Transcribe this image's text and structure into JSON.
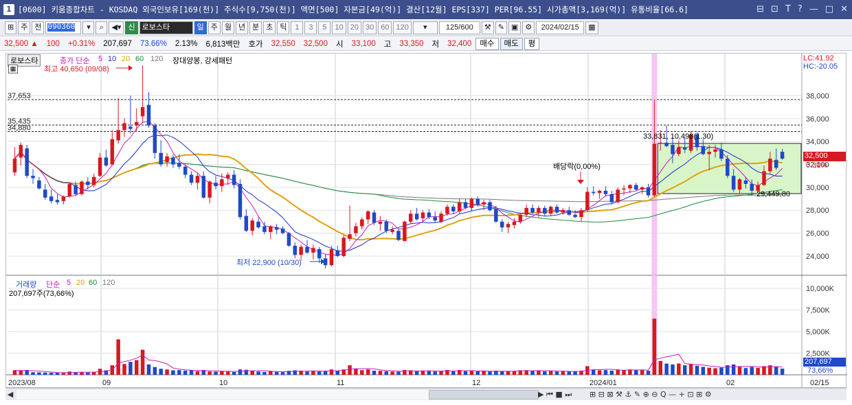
{
  "window": {
    "title": "[0600] 키움종합차트 - KOSDAQ 외국인보유[169(천)] 주식수[9,750(천)] 액면[500] 자본금[49(억)] 결산[12월] EPS[337] PER[96.55] 시가총액[3,169(억)] 유통비율[66.6]",
    "controls": [
      "⊟",
      "⊡",
      "T",
      "?",
      "—",
      "□",
      "✕"
    ]
  },
  "toolbar": {
    "market": "주",
    "prev": "전",
    "code": "090360",
    "robot_label": "신",
    "robot_name": "로보스타",
    "periods": [
      "일",
      "주",
      "월",
      "년",
      "분",
      "초",
      "틱"
    ],
    "period_selected": "일",
    "intervals": [
      "1",
      "3",
      "5",
      "10",
      "20",
      "30",
      "60",
      "120"
    ],
    "count": "125/600",
    "date": "2024/02/15"
  },
  "quote": {
    "price": "32,500",
    "change": "100",
    "rate": "+0.31%",
    "volume": "207,697",
    "vol_ratio": "73.66%",
    "turnover": "2.13%",
    "amount": "6,813백만",
    "ask_label": "호가",
    "ask": "32,550",
    "bid": "32,500",
    "open_label": "시",
    "open": "33,100",
    "high_label": "고",
    "high": "33,350",
    "low_label": "저",
    "low": "32,400",
    "buy_button": "매수",
    "sell_button": "매도",
    "avg_button": "평"
  },
  "chart_data": {
    "type": "candlestick",
    "stock_name": "로보스타",
    "price_legend": {
      "title": "종가 단순",
      "periods": [
        "5",
        "10",
        "20",
        "60",
        "120"
      ],
      "colors": [
        "#c21cbe",
        "#1a2ecb",
        "#e0a010",
        "#1e8a3a",
        "#777777"
      ],
      "pattern": "장대양봉, 강세패턴"
    },
    "lc_label": "LC:41.92",
    "hc_label": "HC:-20.05",
    "price_axis": {
      "ylim": [
        22500,
        40600
      ],
      "ticks": [
        "38,000",
        "36,000",
        "34,000",
        "32,000",
        "30,000",
        "28,000",
        "26,000",
        "24,000"
      ],
      "tick_values": [
        38000,
        36000,
        34000,
        32000,
        30000,
        28000,
        26000,
        24000
      ]
    },
    "reference_lines": [
      {
        "label": "37,653",
        "value": 37653
      },
      {
        "label": "35,435",
        "value": 35435
      },
      {
        "label": "34,880",
        "value": 34880
      }
    ],
    "annotations": {
      "high": "최고 40,650 (09/08)",
      "low": "최저 22,900 (10/30)",
      "dividend": "배당락(0,00%)",
      "box_top": "33,831, 10,498(1.30)",
      "box_bottom": "29,449,80",
      "current_price": "32,500",
      "current_rate": "0.31%"
    },
    "volume_panel": {
      "title": "거래량",
      "ma": "단순",
      "periods": [
        "5",
        "20",
        "60",
        "120"
      ],
      "current": "207,697주(73,66%)",
      "ticks": [
        "10,000K",
        "7,500K",
        "5,000K",
        "2,500K"
      ],
      "tick_values": [
        10000,
        7500,
        5000,
        2500
      ],
      "last_label": "207,697",
      "ratio_label": "73,66%"
    },
    "x_labels": [
      "2023/08",
      "09",
      "10",
      "11",
      "12",
      "2024/01",
      "02",
      "02/15"
    ],
    "candles": [
      {
        "o": 31300,
        "h": 33500,
        "l": 31000,
        "c": 32500
      },
      {
        "o": 32600,
        "h": 33900,
        "l": 31900,
        "c": 33700
      },
      {
        "o": 33400,
        "h": 33700,
        "l": 30800,
        "c": 31000
      },
      {
        "o": 31000,
        "h": 31600,
        "l": 30300,
        "c": 30800
      },
      {
        "o": 30600,
        "h": 30900,
        "l": 29800,
        "c": 29900
      },
      {
        "o": 29800,
        "h": 30300,
        "l": 28900,
        "c": 29100
      },
      {
        "o": 29200,
        "h": 29800,
        "l": 28600,
        "c": 28800
      },
      {
        "o": 28900,
        "h": 29400,
        "l": 28500,
        "c": 28700
      },
      {
        "o": 28800,
        "h": 29300,
        "l": 28500,
        "c": 29200
      },
      {
        "o": 29200,
        "h": 30400,
        "l": 29100,
        "c": 30300
      },
      {
        "o": 30200,
        "h": 30500,
        "l": 29300,
        "c": 29400
      },
      {
        "o": 29400,
        "h": 30600,
        "l": 29300,
        "c": 30500
      },
      {
        "o": 30500,
        "h": 30900,
        "l": 29800,
        "c": 30200
      },
      {
        "o": 30200,
        "h": 31200,
        "l": 30000,
        "c": 30900
      },
      {
        "o": 31000,
        "h": 33000,
        "l": 30900,
        "c": 32600
      },
      {
        "o": 32600,
        "h": 33300,
        "l": 31800,
        "c": 31900
      },
      {
        "o": 32000,
        "h": 35000,
        "l": 31900,
        "c": 34200
      },
      {
        "o": 34100,
        "h": 37800,
        "l": 33800,
        "c": 35000
      },
      {
        "o": 35000,
        "h": 36000,
        "l": 34400,
        "c": 35600
      },
      {
        "o": 35300,
        "h": 38000,
        "l": 34700,
        "c": 35100
      },
      {
        "o": 35400,
        "h": 36900,
        "l": 34900,
        "c": 35700
      },
      {
        "o": 36200,
        "h": 40650,
        "l": 35600,
        "c": 37000
      },
      {
        "o": 37200,
        "h": 38300,
        "l": 35200,
        "c": 35400
      },
      {
        "o": 35400,
        "h": 35600,
        "l": 32500,
        "c": 33000
      },
      {
        "o": 33000,
        "h": 34100,
        "l": 31800,
        "c": 32000
      },
      {
        "o": 32200,
        "h": 33000,
        "l": 31800,
        "c": 32700
      },
      {
        "o": 32600,
        "h": 32900,
        "l": 31700,
        "c": 32000
      },
      {
        "o": 32100,
        "h": 32900,
        "l": 31600,
        "c": 31800
      },
      {
        "o": 31800,
        "h": 32000,
        "l": 30800,
        "c": 31100
      },
      {
        "o": 31100,
        "h": 31400,
        "l": 30200,
        "c": 30400
      },
      {
        "o": 30400,
        "h": 31300,
        "l": 29800,
        "c": 31000
      },
      {
        "o": 31000,
        "h": 31400,
        "l": 29000,
        "c": 29100
      },
      {
        "o": 29100,
        "h": 30600,
        "l": 28600,
        "c": 30500
      },
      {
        "o": 30400,
        "h": 31000,
        "l": 29800,
        "c": 30100
      },
      {
        "o": 30100,
        "h": 31200,
        "l": 29600,
        "c": 30700
      },
      {
        "o": 30800,
        "h": 31300,
        "l": 30200,
        "c": 31100
      },
      {
        "o": 31100,
        "h": 31500,
        "l": 29900,
        "c": 30200
      },
      {
        "o": 30300,
        "h": 30700,
        "l": 27200,
        "c": 27400
      },
      {
        "o": 27500,
        "h": 28100,
        "l": 26100,
        "c": 26200
      },
      {
        "o": 26200,
        "h": 27300,
        "l": 25800,
        "c": 27100
      },
      {
        "o": 27000,
        "h": 27400,
        "l": 26400,
        "c": 26500
      },
      {
        "o": 26600,
        "h": 27000,
        "l": 25900,
        "c": 26100
      },
      {
        "o": 26100,
        "h": 26700,
        "l": 25500,
        "c": 26600
      },
      {
        "o": 26500,
        "h": 26800,
        "l": 25900,
        "c": 26300
      },
      {
        "o": 26400,
        "h": 26600,
        "l": 25900,
        "c": 26000
      },
      {
        "o": 26000,
        "h": 26100,
        "l": 24800,
        "c": 24900
      },
      {
        "o": 24900,
        "h": 25200,
        "l": 23800,
        "c": 24100
      },
      {
        "o": 24100,
        "h": 25000,
        "l": 23600,
        "c": 24800
      },
      {
        "o": 24800,
        "h": 25400,
        "l": 24200,
        "c": 24300
      },
      {
        "o": 24300,
        "h": 25000,
        "l": 23700,
        "c": 24700
      },
      {
        "o": 24600,
        "h": 24800,
        "l": 23400,
        "c": 23800
      },
      {
        "o": 23800,
        "h": 24200,
        "l": 22900,
        "c": 23200
      },
      {
        "o": 23200,
        "h": 24900,
        "l": 23100,
        "c": 24600
      },
      {
        "o": 24500,
        "h": 24900,
        "l": 23900,
        "c": 24000
      },
      {
        "o": 24000,
        "h": 25800,
        "l": 23900,
        "c": 25600
      },
      {
        "o": 25500,
        "h": 28400,
        "l": 25300,
        "c": 25900
      },
      {
        "o": 26000,
        "h": 26900,
        "l": 25700,
        "c": 26600
      },
      {
        "o": 26600,
        "h": 27400,
        "l": 26300,
        "c": 27200
      },
      {
        "o": 27200,
        "h": 28000,
        "l": 26800,
        "c": 27900
      },
      {
        "o": 27800,
        "h": 28000,
        "l": 26700,
        "c": 26900
      },
      {
        "o": 26800,
        "h": 27500,
        "l": 26200,
        "c": 27000
      },
      {
        "o": 27000,
        "h": 27200,
        "l": 26000,
        "c": 26200
      },
      {
        "o": 26100,
        "h": 26600,
        "l": 25900,
        "c": 26300
      },
      {
        "o": 26200,
        "h": 26400,
        "l": 25300,
        "c": 25400
      },
      {
        "o": 25300,
        "h": 27100,
        "l": 25300,
        "c": 27000
      },
      {
        "o": 27000,
        "h": 28000,
        "l": 26800,
        "c": 27700
      },
      {
        "o": 27700,
        "h": 28200,
        "l": 27100,
        "c": 27200
      },
      {
        "o": 27300,
        "h": 28000,
        "l": 27000,
        "c": 27800
      },
      {
        "o": 27800,
        "h": 28100,
        "l": 27200,
        "c": 27400
      },
      {
        "o": 27400,
        "h": 27900,
        "l": 26900,
        "c": 27100
      },
      {
        "o": 27000,
        "h": 27900,
        "l": 26900,
        "c": 27700
      },
      {
        "o": 27700,
        "h": 28500,
        "l": 27500,
        "c": 28300
      },
      {
        "o": 28300,
        "h": 28500,
        "l": 27700,
        "c": 27900
      },
      {
        "o": 27900,
        "h": 29000,
        "l": 27700,
        "c": 28700
      },
      {
        "o": 28700,
        "h": 29000,
        "l": 28100,
        "c": 28200
      },
      {
        "o": 28200,
        "h": 29100,
        "l": 27900,
        "c": 29000
      },
      {
        "o": 29000,
        "h": 29200,
        "l": 28300,
        "c": 28500
      },
      {
        "o": 28500,
        "h": 28900,
        "l": 28000,
        "c": 28700
      },
      {
        "o": 28700,
        "h": 28900,
        "l": 27900,
        "c": 28000
      },
      {
        "o": 28100,
        "h": 28400,
        "l": 26900,
        "c": 27000
      },
      {
        "o": 27000,
        "h": 27200,
        "l": 26100,
        "c": 26500
      },
      {
        "o": 26500,
        "h": 27000,
        "l": 26000,
        "c": 26800
      },
      {
        "o": 26700,
        "h": 27300,
        "l": 26400,
        "c": 27000
      },
      {
        "o": 27000,
        "h": 27800,
        "l": 26800,
        "c": 27600
      },
      {
        "o": 27600,
        "h": 28500,
        "l": 27400,
        "c": 28200
      },
      {
        "o": 28200,
        "h": 28500,
        "l": 27700,
        "c": 27800
      },
      {
        "o": 27800,
        "h": 28400,
        "l": 27400,
        "c": 28200
      },
      {
        "o": 28200,
        "h": 28400,
        "l": 27500,
        "c": 27700
      },
      {
        "o": 27700,
        "h": 28400,
        "l": 27500,
        "c": 28300
      },
      {
        "o": 28300,
        "h": 28500,
        "l": 27700,
        "c": 27800
      },
      {
        "o": 27800,
        "h": 28200,
        "l": 27600,
        "c": 28000
      },
      {
        "o": 28000,
        "h": 28300,
        "l": 27500,
        "c": 27600
      },
      {
        "o": 27600,
        "h": 28000,
        "l": 27300,
        "c": 27400
      },
      {
        "o": 27400,
        "h": 28200,
        "l": 27000,
        "c": 28000
      },
      {
        "o": 28000,
        "h": 30000,
        "l": 27900,
        "c": 29600
      },
      {
        "o": 29600,
        "h": 30100,
        "l": 29300,
        "c": 29500
      },
      {
        "o": 29500,
        "h": 29800,
        "l": 29000,
        "c": 29700
      },
      {
        "o": 29700,
        "h": 30100,
        "l": 29200,
        "c": 29400
      },
      {
        "o": 29400,
        "h": 29700,
        "l": 28500,
        "c": 28700
      },
      {
        "o": 28700,
        "h": 30000,
        "l": 28600,
        "c": 29800
      },
      {
        "o": 29800,
        "h": 30200,
        "l": 29300,
        "c": 29900
      },
      {
        "o": 29900,
        "h": 30300,
        "l": 29500,
        "c": 30200
      },
      {
        "o": 30200,
        "h": 30400,
        "l": 29700,
        "c": 29800
      },
      {
        "o": 29800,
        "h": 30100,
        "l": 29400,
        "c": 30000
      },
      {
        "o": 30000,
        "h": 30300,
        "l": 29100,
        "c": 29300
      },
      {
        "o": 29300,
        "h": 37653,
        "l": 29200,
        "c": 33800
      },
      {
        "o": 33800,
        "h": 35000,
        "l": 33200,
        "c": 33900
      },
      {
        "o": 33900,
        "h": 35400,
        "l": 33500,
        "c": 33600
      },
      {
        "o": 33700,
        "h": 34500,
        "l": 32100,
        "c": 32900
      },
      {
        "o": 32900,
        "h": 34100,
        "l": 32700,
        "c": 33500
      },
      {
        "o": 33500,
        "h": 34300,
        "l": 33000,
        "c": 33300
      },
      {
        "o": 33200,
        "h": 34900,
        "l": 33000,
        "c": 34600
      },
      {
        "o": 34600,
        "h": 34800,
        "l": 33200,
        "c": 33500
      },
      {
        "o": 33600,
        "h": 34200,
        "l": 32800,
        "c": 32900
      },
      {
        "o": 32900,
        "h": 33700,
        "l": 31500,
        "c": 33100
      },
      {
        "o": 33100,
        "h": 33700,
        "l": 32600,
        "c": 33300
      },
      {
        "o": 33300,
        "h": 33900,
        "l": 32300,
        "c": 32500
      },
      {
        "o": 32500,
        "h": 32800,
        "l": 30800,
        "c": 31000
      },
      {
        "o": 31000,
        "h": 31600,
        "l": 29600,
        "c": 29800
      },
      {
        "o": 29800,
        "h": 30800,
        "l": 29500,
        "c": 30700
      },
      {
        "o": 30600,
        "h": 30900,
        "l": 29900,
        "c": 30300
      },
      {
        "o": 30300,
        "h": 30700,
        "l": 29300,
        "c": 29700
      },
      {
        "o": 29700,
        "h": 30500,
        "l": 29500,
        "c": 30200
      },
      {
        "o": 30200,
        "h": 31900,
        "l": 30100,
        "c": 31400
      },
      {
        "o": 31400,
        "h": 33100,
        "l": 31200,
        "c": 32500
      },
      {
        "o": 32400,
        "h": 33400,
        "l": 31500,
        "c": 31700
      },
      {
        "o": 33100,
        "h": 33350,
        "l": 32400,
        "c": 32500
      }
    ],
    "volumes": [
      520,
      480,
      560,
      300,
      280,
      260,
      240,
      250,
      220,
      380,
      300,
      330,
      260,
      300,
      700,
      520,
      1100,
      4100,
      1250,
      1500,
      1700,
      2900,
      1200,
      900,
      700,
      620,
      520,
      540,
      480,
      520,
      420,
      560,
      380,
      360,
      420,
      380,
      320,
      620,
      580,
      440,
      380,
      330,
      400,
      340,
      300,
      460,
      520,
      480,
      380,
      420,
      380,
      460,
      620,
      480,
      620,
      1100,
      700,
      540,
      620,
      480,
      460,
      420,
      380,
      360,
      560,
      520,
      400,
      480,
      420,
      380,
      460,
      560,
      400,
      560,
      420,
      460,
      400,
      420,
      380,
      480,
      430,
      400,
      440,
      520,
      540,
      460,
      480,
      400,
      460,
      380,
      420,
      380,
      360,
      480,
      1000,
      620,
      520,
      540,
      480,
      620,
      540,
      620,
      520,
      540,
      460,
      6500,
      1600,
      1300,
      1200,
      1300,
      1100,
      1250,
      1050,
      920,
      820,
      760,
      820,
      1100,
      1200,
      920,
      780,
      900,
      800,
      1000,
      1100,
      920,
      720
    ]
  },
  "statusbar": {
    "left": "◀",
    "controls": "▶ ⏮ ■ ⏭",
    "tools": "⊞ ⊟ ⊠ ⚒ ⚓ ✎ ⊕ ⊖ Q — + ⊡ ⊞ ⚙"
  }
}
